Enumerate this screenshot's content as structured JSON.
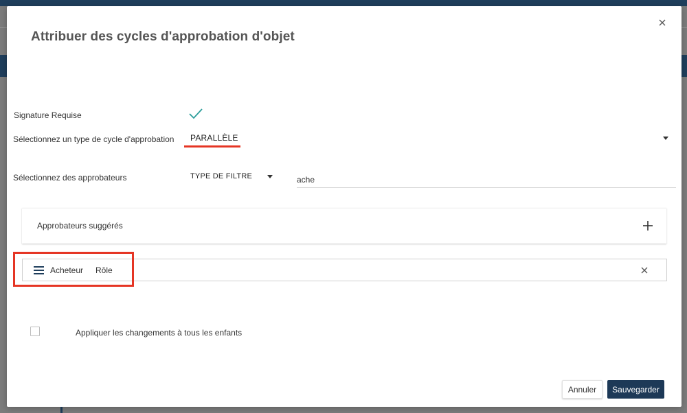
{
  "dialog": {
    "title": "Attribuer des cycles d'approbation d'objet"
  },
  "form": {
    "signature_label": "Signature Requise",
    "signature_checked": true,
    "cycle_type_label": "Sélectionnez un type de cycle d'approbation",
    "cycle_type_value": "PARALLÈLE",
    "approvers_label": "Sélectionnez des approbateurs",
    "filter_type_value": "TYPE DE FILTRE",
    "search_value": "ache"
  },
  "suggested": {
    "title": "Approbateurs suggérés"
  },
  "approvers": [
    {
      "name": "Acheteur",
      "type": "Rôle"
    }
  ],
  "apply_children": {
    "label": "Appliquer les changements à tous les enfants",
    "checked": false
  },
  "buttons": {
    "cancel": "Annuler",
    "save": "Sauvegarder"
  },
  "colors": {
    "primary": "#1d3957",
    "accent_check": "#2a9d9a",
    "highlight": "#e53524"
  },
  "icons": {
    "close": "close-icon",
    "check": "check-icon",
    "add": "plus-icon",
    "drag": "hamburger-icon",
    "remove": "remove-icon",
    "dropdown": "chevron-down-icon"
  }
}
